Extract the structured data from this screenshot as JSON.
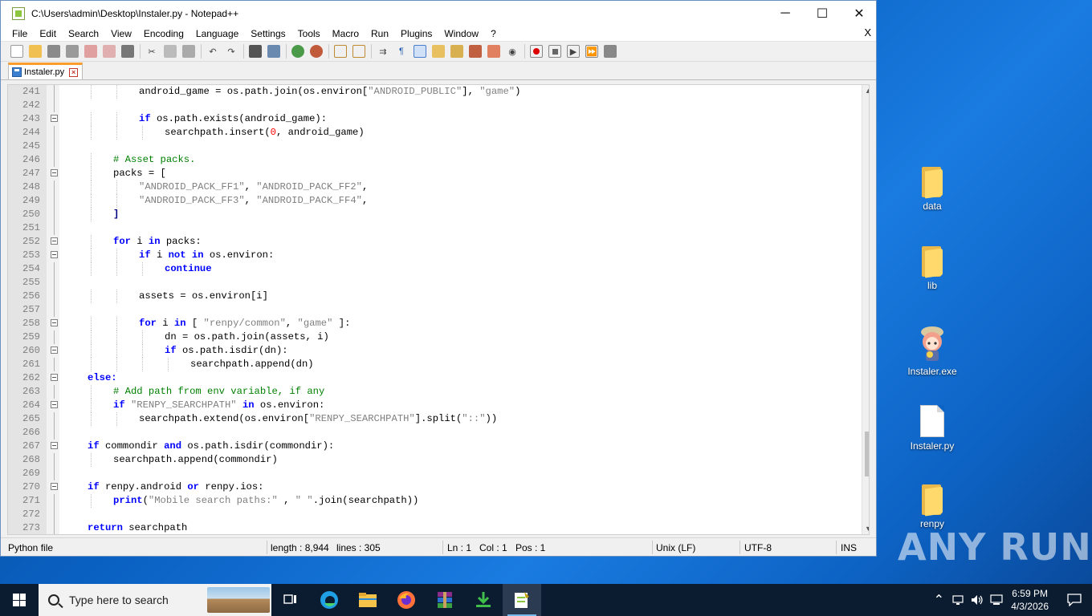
{
  "window": {
    "title": "C:\\Users\\admin\\Desktop\\Instaler.py - Notepad++",
    "controls": {
      "minimize": "─",
      "maximize": "☐",
      "close": "✕"
    }
  },
  "menu": {
    "items": [
      "File",
      "Edit",
      "Search",
      "View",
      "Encoding",
      "Language",
      "Settings",
      "Tools",
      "Macro",
      "Run",
      "Plugins",
      "Window",
      "?"
    ],
    "close_doc": "X"
  },
  "toolbar": {
    "icons": [
      "new-file",
      "open-file",
      "save",
      "save-all",
      "close",
      "close-all",
      "print",
      "cut",
      "copy",
      "paste",
      "undo",
      "redo",
      "find",
      "replace",
      "zoom-in",
      "zoom-out",
      "sync-vertical",
      "sync-horizontal",
      "word-wrap",
      "show-all-chars",
      "indent-guide",
      "user-language",
      "document-map",
      "function-list",
      "folder-as-workspace",
      "monitoring",
      "record-macro",
      "stop-record",
      "play-macro",
      "run-macro-multiple",
      "save-macro"
    ]
  },
  "tab": {
    "label": "Instaler.py"
  },
  "editor": {
    "lines": [
      {
        "n": "241",
        "fold": "vline",
        "indent": 3,
        "tokens": [
          {
            "t": "android_game = os.path.join(os.environ[",
            "c": ""
          },
          {
            "t": "\"ANDROID_PUBLIC\"",
            "c": "str"
          },
          {
            "t": "], ",
            "c": ""
          },
          {
            "t": "\"game\"",
            "c": "str"
          },
          {
            "t": ")",
            "c": ""
          }
        ]
      },
      {
        "n": "242",
        "fold": "vline",
        "indent": 0,
        "tokens": []
      },
      {
        "n": "243",
        "fold": "box",
        "indent": 3,
        "tokens": [
          {
            "t": "if",
            "c": "kw"
          },
          {
            "t": " os.path.exists(android_game):",
            "c": ""
          }
        ]
      },
      {
        "n": "244",
        "fold": "vline",
        "indent": 4,
        "tokens": [
          {
            "t": "searchpath.insert(",
            "c": ""
          },
          {
            "t": "0",
            "c": "num"
          },
          {
            "t": ", android_game)",
            "c": ""
          }
        ]
      },
      {
        "n": "245",
        "fold": "vline",
        "indent": 0,
        "tokens": []
      },
      {
        "n": "246",
        "fold": "vline",
        "indent": 2,
        "tokens": [
          {
            "t": "# Asset packs.",
            "c": "cm"
          }
        ]
      },
      {
        "n": "247",
        "fold": "box",
        "indent": 2,
        "tokens": [
          {
            "t": "packs = [",
            "c": ""
          }
        ]
      },
      {
        "n": "248",
        "fold": "vline",
        "indent": 3,
        "tokens": [
          {
            "t": "\"ANDROID_PACK_FF1\"",
            "c": "str"
          },
          {
            "t": ", ",
            "c": ""
          },
          {
            "t": "\"ANDROID_PACK_FF2\"",
            "c": "str"
          },
          {
            "t": ",",
            "c": ""
          }
        ]
      },
      {
        "n": "249",
        "fold": "vline",
        "indent": 3,
        "tokens": [
          {
            "t": "\"ANDROID_PACK_FF3\"",
            "c": "str"
          },
          {
            "t": ", ",
            "c": ""
          },
          {
            "t": "\"ANDROID_PACK_FF4\"",
            "c": "str"
          },
          {
            "t": ",",
            "c": ""
          }
        ]
      },
      {
        "n": "250",
        "fold": "vline",
        "indent": 2,
        "tokens": [
          {
            "t": "]",
            "c": "op"
          }
        ]
      },
      {
        "n": "251",
        "fold": "vline",
        "indent": 0,
        "tokens": []
      },
      {
        "n": "252",
        "fold": "box",
        "indent": 2,
        "tokens": [
          {
            "t": "for",
            "c": "kw"
          },
          {
            "t": " i ",
            "c": ""
          },
          {
            "t": "in",
            "c": "kw"
          },
          {
            "t": " packs:",
            "c": ""
          }
        ]
      },
      {
        "n": "253",
        "fold": "box",
        "indent": 3,
        "tokens": [
          {
            "t": "if",
            "c": "kw"
          },
          {
            "t": " i ",
            "c": ""
          },
          {
            "t": "not",
            "c": "kw"
          },
          {
            "t": " ",
            "c": ""
          },
          {
            "t": "in",
            "c": "kw"
          },
          {
            "t": " os.environ:",
            "c": ""
          }
        ]
      },
      {
        "n": "254",
        "fold": "vline",
        "indent": 4,
        "tokens": [
          {
            "t": "continue",
            "c": "kw"
          }
        ]
      },
      {
        "n": "255",
        "fold": "vline",
        "indent": 0,
        "tokens": []
      },
      {
        "n": "256",
        "fold": "vline",
        "indent": 3,
        "tokens": [
          {
            "t": "assets = os.environ[i]",
            "c": ""
          }
        ]
      },
      {
        "n": "257",
        "fold": "vline",
        "indent": 0,
        "tokens": []
      },
      {
        "n": "258",
        "fold": "box",
        "indent": 3,
        "tokens": [
          {
            "t": "for",
            "c": "kw"
          },
          {
            "t": " i ",
            "c": ""
          },
          {
            "t": "in",
            "c": "kw"
          },
          {
            "t": " [ ",
            "c": ""
          },
          {
            "t": "\"renpy/common\"",
            "c": "str"
          },
          {
            "t": ", ",
            "c": ""
          },
          {
            "t": "\"game\"",
            "c": "str"
          },
          {
            "t": " ]:",
            "c": ""
          }
        ]
      },
      {
        "n": "259",
        "fold": "vline",
        "indent": 4,
        "tokens": [
          {
            "t": "dn = os.path.join(assets, i)",
            "c": ""
          }
        ]
      },
      {
        "n": "260",
        "fold": "box",
        "indent": 4,
        "tokens": [
          {
            "t": "if",
            "c": "kw"
          },
          {
            "t": " os.path.isdir(dn):",
            "c": ""
          }
        ]
      },
      {
        "n": "261",
        "fold": "vline",
        "indent": 5,
        "tokens": [
          {
            "t": "searchpath.append(dn)",
            "c": ""
          }
        ]
      },
      {
        "n": "262",
        "fold": "box",
        "indent": 1,
        "tokens": [
          {
            "t": "else:",
            "c": "kw"
          }
        ]
      },
      {
        "n": "263",
        "fold": "vline",
        "indent": 2,
        "tokens": [
          {
            "t": "# Add path from env variable, if any",
            "c": "cm"
          }
        ]
      },
      {
        "n": "264",
        "fold": "box",
        "indent": 2,
        "tokens": [
          {
            "t": "if",
            "c": "kw"
          },
          {
            "t": " ",
            "c": ""
          },
          {
            "t": "\"RENPY_SEARCHPATH\"",
            "c": "str"
          },
          {
            "t": " ",
            "c": ""
          },
          {
            "t": "in",
            "c": "kw"
          },
          {
            "t": " os.environ:",
            "c": ""
          }
        ]
      },
      {
        "n": "265",
        "fold": "vline",
        "indent": 3,
        "tokens": [
          {
            "t": "searchpath.extend(os.environ[",
            "c": ""
          },
          {
            "t": "\"RENPY_SEARCHPATH\"",
            "c": "str"
          },
          {
            "t": "].split(",
            "c": ""
          },
          {
            "t": "\"::\"",
            "c": "str"
          },
          {
            "t": "))",
            "c": ""
          }
        ]
      },
      {
        "n": "266",
        "fold": "vline",
        "indent": 0,
        "tokens": []
      },
      {
        "n": "267",
        "fold": "box",
        "indent": 1,
        "tokens": [
          {
            "t": "if",
            "c": "kw"
          },
          {
            "t": " commondir ",
            "c": ""
          },
          {
            "t": "and",
            "c": "kw"
          },
          {
            "t": " os.path.isdir(commondir):",
            "c": ""
          }
        ]
      },
      {
        "n": "268",
        "fold": "vline",
        "indent": 2,
        "tokens": [
          {
            "t": "searchpath.append(commondir)",
            "c": ""
          }
        ]
      },
      {
        "n": "269",
        "fold": "vline",
        "indent": 0,
        "tokens": []
      },
      {
        "n": "270",
        "fold": "box",
        "indent": 1,
        "tokens": [
          {
            "t": "if",
            "c": "kw"
          },
          {
            "t": " renpy.android ",
            "c": ""
          },
          {
            "t": "or",
            "c": "kw"
          },
          {
            "t": " renpy.ios:",
            "c": ""
          }
        ]
      },
      {
        "n": "271",
        "fold": "vline",
        "indent": 2,
        "tokens": [
          {
            "t": "print",
            "c": "kw"
          },
          {
            "t": "(",
            "c": ""
          },
          {
            "t": "\"Mobile search paths:\"",
            "c": "str"
          },
          {
            "t": " , ",
            "c": ""
          },
          {
            "t": "\" \"",
            "c": "str"
          },
          {
            "t": ".join(searchpath))",
            "c": ""
          }
        ]
      },
      {
        "n": "272",
        "fold": "vline",
        "indent": 0,
        "tokens": []
      },
      {
        "n": "273",
        "fold": "vline",
        "indent": 1,
        "tokens": [
          {
            "t": "return",
            "c": "kw"
          },
          {
            "t": " searchpath",
            "c": ""
          }
        ]
      }
    ]
  },
  "statusbar": {
    "filetype": "Python file",
    "length": "length : 8,944",
    "lines": "lines : 305",
    "ln": "Ln : 1",
    "col": "Col : 1",
    "pos": "Pos : 1",
    "eol": "Unix (LF)",
    "encoding": "UTF-8",
    "mode": "INS"
  },
  "desktop": {
    "icons": [
      {
        "label": "data",
        "type": "folder"
      },
      {
        "label": "lib",
        "type": "folder"
      },
      {
        "label": "Instaler.exe",
        "type": "exe"
      },
      {
        "label": "Instaler.py",
        "type": "file"
      },
      {
        "label": "renpy",
        "type": "folder"
      }
    ],
    "watermark": "ANY RUN"
  },
  "taskbar": {
    "search_placeholder": "Type here to search",
    "apps": [
      "task-view",
      "edge",
      "file-explorer",
      "firefox",
      "winrar",
      "downloads",
      "notepad-plus-plus"
    ],
    "time": "6:59 PM",
    "date": "4/3/2026"
  },
  "colors": {
    "accent_tab": "#fa9d2c",
    "keyword": "#0000ff",
    "string": "#808080",
    "comment": "#008000",
    "number": "#ff0000"
  }
}
